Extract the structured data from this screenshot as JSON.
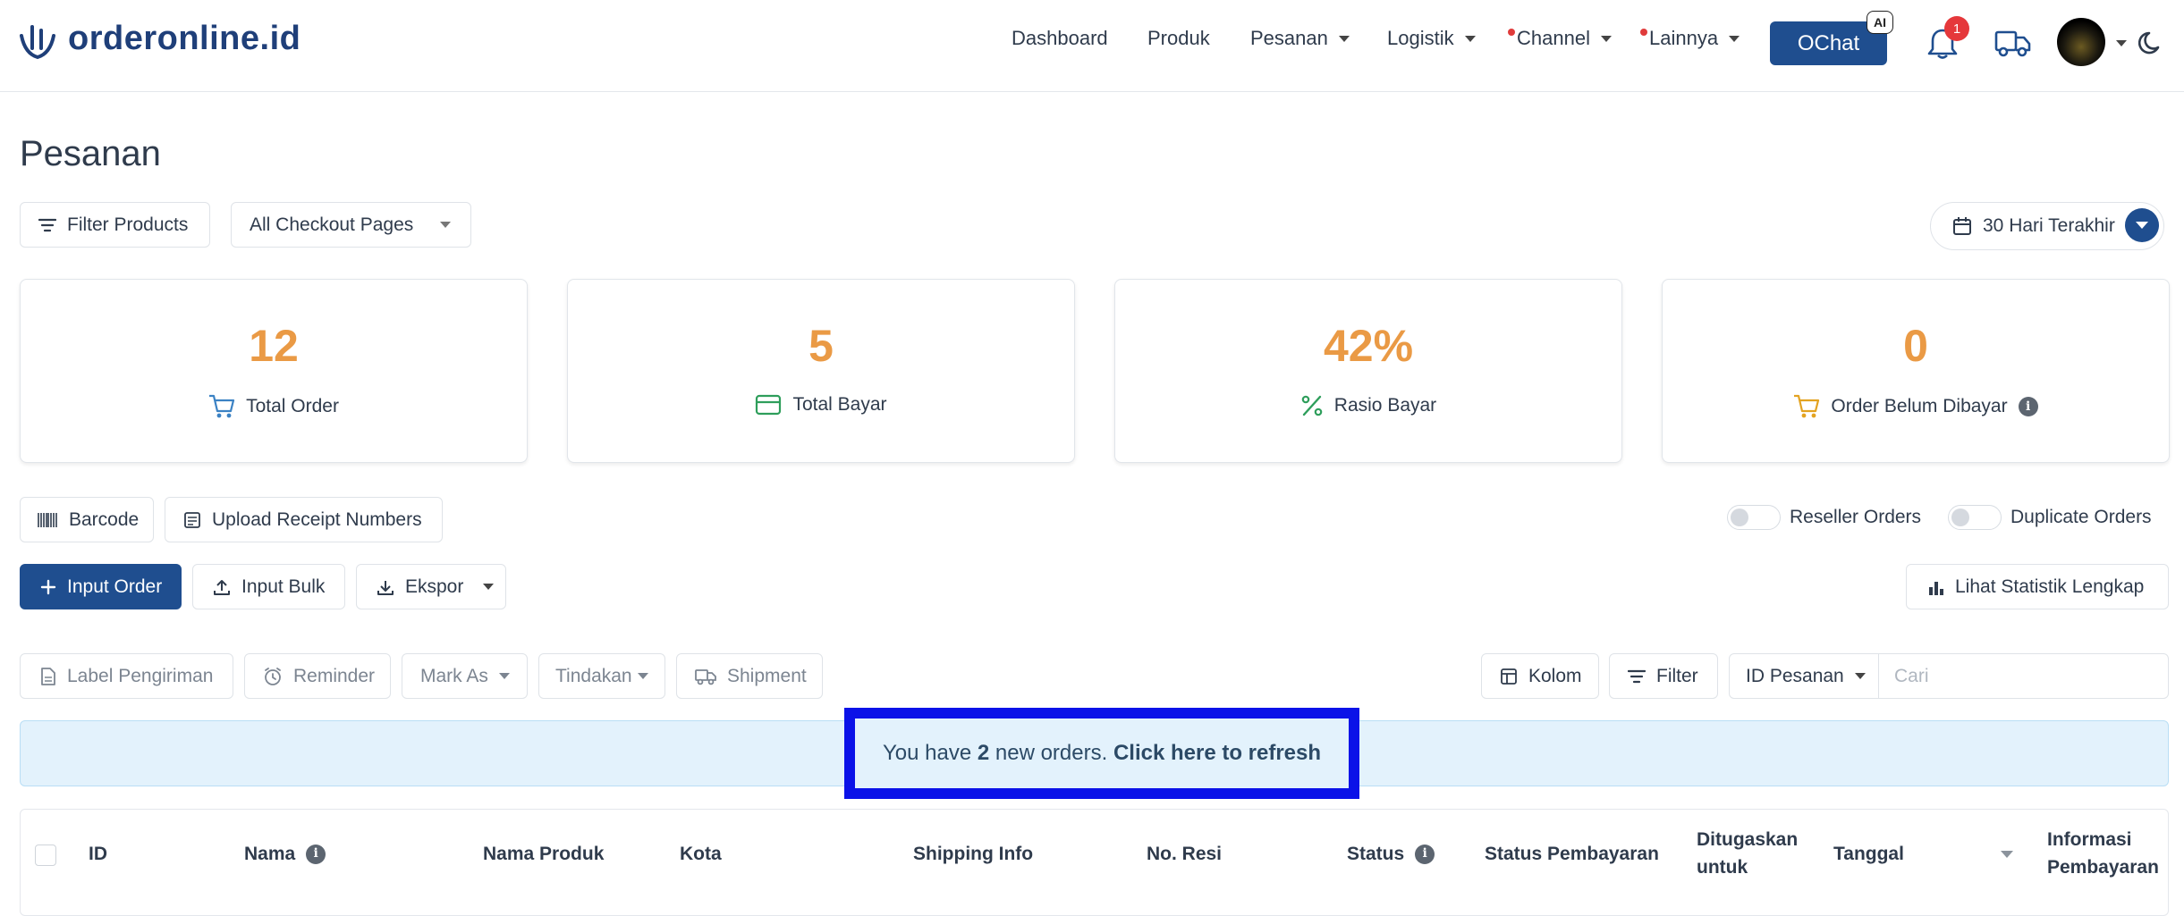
{
  "brand": {
    "name": "orderonline.id"
  },
  "nav": {
    "items": [
      "Dashboard",
      "Produk",
      "Pesanan",
      "Logistik",
      "Channel",
      "Lainnya"
    ],
    "ochat": "OChat",
    "ai_badge": "AI",
    "notification_count": "1"
  },
  "page": {
    "title": "Pesanan"
  },
  "filters": {
    "filter_products": "Filter Products",
    "checkout_pages": "All Checkout Pages",
    "date_range": "30 Hari Terakhir"
  },
  "stats": [
    {
      "value": "12",
      "label": "Total Order",
      "icon": "cart-icon"
    },
    {
      "value": "5",
      "label": "Total Bayar",
      "icon": "credit-card-icon"
    },
    {
      "value": "42%",
      "label": "Rasio Bayar",
      "icon": "percent-icon"
    },
    {
      "value": "0",
      "label": "Order Belum Dibayar",
      "icon": "cart-icon"
    }
  ],
  "actions": {
    "barcode": "Barcode",
    "upload_receipt": "Upload Receipt Numbers",
    "reseller_orders": "Reseller Orders",
    "duplicate_orders": "Duplicate Orders",
    "input_order": "Input Order",
    "input_bulk": "Input Bulk",
    "ekspor": "Ekspor",
    "statistik": "Lihat Statistik Lengkap"
  },
  "toolbar": {
    "label_pengiriman": "Label Pengiriman",
    "reminder": "Reminder",
    "mark_as": "Mark As",
    "tindakan": "Tindakan",
    "shipment": "Shipment",
    "kolom": "Kolom",
    "filter": "Filter",
    "search_field": "ID Pesanan",
    "search_placeholder": "Cari"
  },
  "banner": {
    "prefix": "You have",
    "count": "2",
    "middle": "new orders.",
    "action": "Click here to refresh"
  },
  "table": {
    "columns": [
      "ID",
      "Nama",
      "Nama Produk",
      "Kota",
      "Shipping Info",
      "No. Resi",
      "Status",
      "Status Pembayaran",
      "Ditugaskan untuk",
      "Tanggal",
      "Informasi Pembayaran"
    ]
  },
  "colors": {
    "primary": "#1f4e8f",
    "stat_value": "#ea9a45",
    "banner_bg": "#e3f2fc",
    "highlight_border": "#0b12e8"
  }
}
